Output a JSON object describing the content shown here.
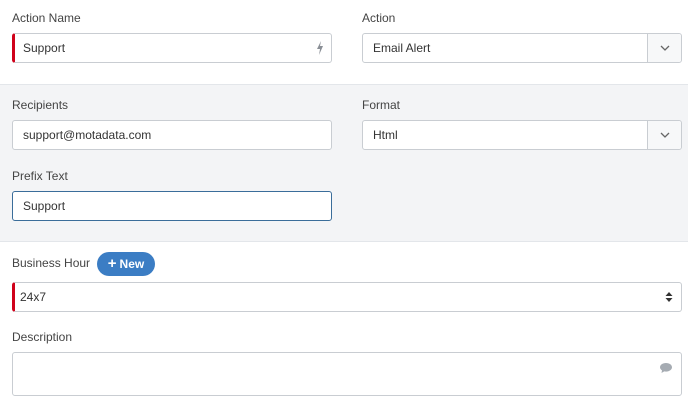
{
  "action_name": {
    "label": "Action Name",
    "value": "Support"
  },
  "action": {
    "label": "Action",
    "value": "Email Alert"
  },
  "recipients": {
    "label": "Recipients",
    "value": "support@motadata.com"
  },
  "format": {
    "label": "Format",
    "value": "Html"
  },
  "prefix_text": {
    "label": "Prefix Text",
    "value": "Support"
  },
  "business_hour": {
    "label": "Business Hour",
    "new_label": "New",
    "value": "24x7"
  },
  "description": {
    "label": "Description",
    "value": ""
  },
  "colors": {
    "required": "#d0021b",
    "accent": "#3b7dc4",
    "panel": "#f3f4f6"
  }
}
